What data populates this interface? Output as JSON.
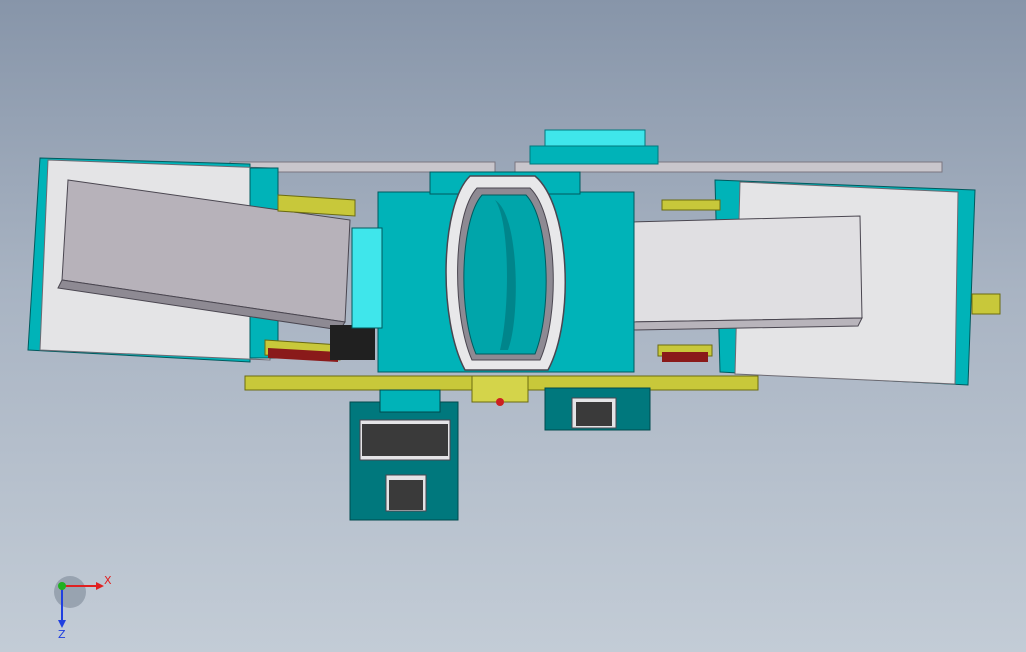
{
  "viewport": {
    "background_top": "#8795a9",
    "background_bottom": "#c3ccd6"
  },
  "model": {
    "colors": {
      "teal": "#00b3b8",
      "teal_dark": "#00787d",
      "teal_light": "#3fe6eb",
      "gray_light": "#e2e2e4",
      "gray_mid": "#b8b4bb",
      "gray_dark": "#8e8a93",
      "yellow": "#c8c83a",
      "yellow_dark": "#9c9c22",
      "red": "#8a1a1a",
      "black": "#202020"
    }
  },
  "triad": {
    "x_label": "X",
    "z_label": "Z",
    "x_color": "#e02020",
    "y_color": "#20b020",
    "z_color": "#2040e0"
  }
}
